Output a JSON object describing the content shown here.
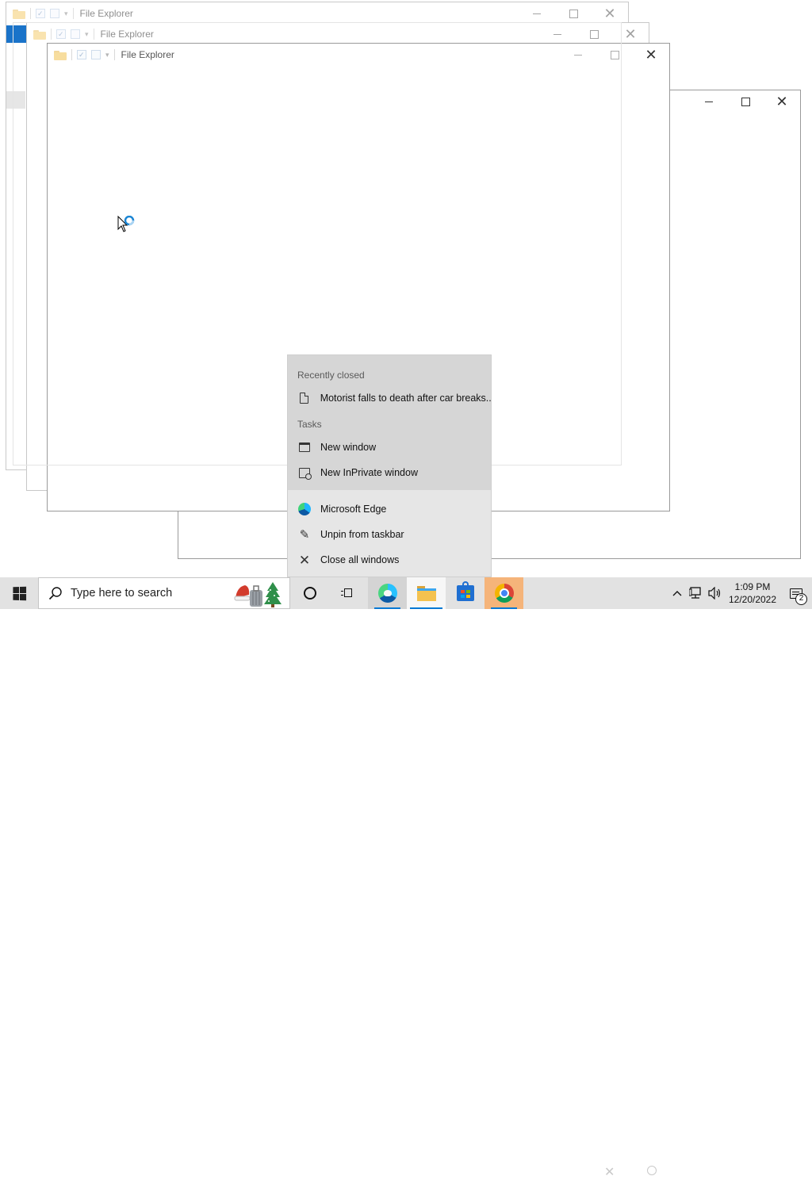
{
  "windows": [
    {
      "title": "File Explorer"
    },
    {
      "title": "File Explorer"
    },
    {
      "title": "File Explorer"
    }
  ],
  "jump_list": {
    "recently_closed_header": "Recently closed",
    "recent_item": "Motorist falls to death after car breaks...",
    "tasks_header": "Tasks",
    "tasks": [
      "New window",
      "New InPrivate window"
    ],
    "app_name": "Microsoft Edge",
    "unpin": "Unpin from taskbar",
    "close_all": "Close all windows"
  },
  "taskbar": {
    "search_placeholder": "Type here to search",
    "apps": [
      "cortana-icon",
      "task-view-icon",
      "edge-icon",
      "file-explorer-icon",
      "microsoft-store-icon",
      "chrome-icon"
    ],
    "time": "1:09 PM",
    "date": "12/20/2022",
    "notification_count": "2"
  },
  "colors": {
    "taskbar_bg": "#e2e2e2",
    "accent": "#0078d4",
    "jump_list_top": "#d6d6d6",
    "jump_list_bottom": "#e6e6e6",
    "chrome_highlight": "#f5b47a"
  }
}
